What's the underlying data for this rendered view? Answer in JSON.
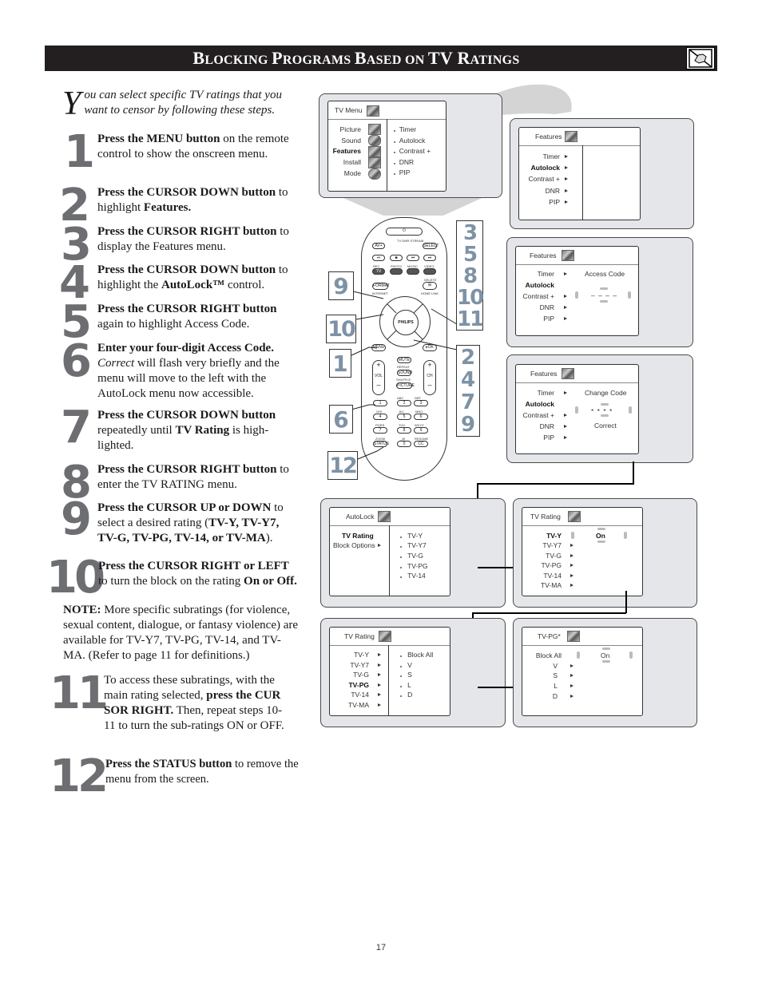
{
  "header": {
    "title_parts": [
      {
        "big": "B",
        "small": "LOCKING "
      },
      {
        "big": "P",
        "small": "ROGRAMS "
      },
      {
        "big": "B",
        "small": "ASED ON "
      },
      {
        "big": "TV R",
        "small": "ATINGS"
      }
    ],
    "icon": "hand-pointer-icon"
  },
  "intro": {
    "drop_cap": "Y",
    "text": "ou can select specific TV ratings that you want to censor by following these steps."
  },
  "steps": [
    {
      "num": "1",
      "bold": "Press the MENU button",
      "rest": " on the remote control to show the onscreen menu."
    },
    {
      "num": "2",
      "bold": "Press the CURSOR DOWN button",
      "rest": " to highlight ",
      "bold2": "Features."
    },
    {
      "num": "3",
      "bold": "Press the CURSOR RIGHT button",
      "rest": " to display the Features menu."
    },
    {
      "num": "4",
      "bold": "Press the CURSOR DOWN button",
      "rest": " to highlight the ",
      "bold2": "AutoLock™",
      "rest2": " control."
    },
    {
      "num": "5",
      "bold": "Press the CURSOR RIGHT button",
      "rest": " again to highlight Access Code."
    },
    {
      "num": "6",
      "bold": "Enter your four-digit Access Code.",
      "italic": "Correct",
      "rest": " will flash very briefly and the menu will move to the left with the AutoLock menu now accessible."
    },
    {
      "num": "7",
      "bold": "Press the CURSOR DOWN button",
      "rest": " repeatedly until ",
      "bold2": "TV Rating",
      "rest2": " is high-lighted."
    },
    {
      "num": "8",
      "bold": "Press the CURSOR RIGHT button",
      "rest": " to enter the TV RATING menu."
    },
    {
      "num": "9",
      "bold": "Press the CURSOR UP or DOWN",
      "rest": " to select a desired rating (",
      "bold2": "TV-Y, TV-Y7, TV-G, TV-PG, TV-14, or TV-MA",
      "rest2": ")."
    },
    {
      "num": "10",
      "bold": "Press the CURSOR RIGHT or LEFT",
      "rest": " to turn the block on the rating ",
      "bold2": "On or Off."
    },
    {
      "num": "11",
      "rest": "To access these subratings, with the main rating selected, ",
      "bold": "press the CUR SOR RIGHT.",
      "rest2": " Then, repeat steps 10-11 to turn the sub-ratings ON or OFF."
    },
    {
      "num": "12",
      "bold": "Press the STATUS button",
      "rest": " to remove the menu from the screen."
    }
  ],
  "note": {
    "label": "NOTE:",
    "text": " More specific subratings (for violence, sexual content, dialogue, or fantasy violence) are available for TV-Y7, TV-PG, TV-14, and TV-MA. (Refer to page 11 for definitions.)"
  },
  "screens": {
    "tv_menu": {
      "title": "TV Menu",
      "left": [
        "Picture",
        "Sound",
        "Features",
        "Install",
        "Mode"
      ],
      "highlight": "Features",
      "right": [
        "Timer",
        "Autolock",
        "Contrast +",
        "DNR",
        "PIP"
      ]
    },
    "features_1": {
      "title": "Features",
      "items": [
        "Timer",
        "Autolock",
        "Contrast +",
        "DNR",
        "PIP"
      ],
      "highlight": "Autolock"
    },
    "features_2": {
      "title": "Features",
      "items": [
        "Timer",
        "Autolock",
        "Contrast +",
        "DNR",
        "PIP"
      ],
      "highlight": "Autolock",
      "field_label": "Access Code",
      "field_value": "– – – –"
    },
    "features_3": {
      "title": "Features",
      "items": [
        "Timer",
        "Autolock",
        "Contrast +",
        "DNR",
        "PIP"
      ],
      "highlight": "Autolock",
      "field_label": "Change Code",
      "field_value": "* * * *",
      "status": "Correct"
    },
    "autolock": {
      "title": "AutoLock",
      "left": [
        "TV Rating",
        "Block Options"
      ],
      "highlight": "TV Rating",
      "right": [
        "TV-Y",
        "TV-Y7",
        "TV-G",
        "TV-PG",
        "TV-14"
      ]
    },
    "tv_rating_1": {
      "title": "TV Rating",
      "items": [
        "TV-Y",
        "TV-Y7",
        "TV-G",
        "TV-PG",
        "TV-14",
        "TV-MA"
      ],
      "highlight": "TV-Y",
      "value": "On"
    },
    "tv_rating_2": {
      "title": "TV Rating",
      "items": [
        "TV-Y",
        "TV-Y7",
        "TV-G",
        "TV-PG",
        "TV-14",
        "TV-MA"
      ],
      "highlight": "TV-PG",
      "right": [
        "Block All",
        "V",
        "S",
        "L",
        "D"
      ]
    },
    "tv_pg": {
      "title": "TV-PG*",
      "items": [
        "Block All",
        "V",
        "S",
        "L",
        "D"
      ],
      "highlight": "Block All",
      "value": "On"
    }
  },
  "remote": {
    "brand": "PHILIPS",
    "top_labels": [
      "TV",
      "DMR",
      "STREAM"
    ],
    "buttons": {
      "av": "AV+",
      "select": "SELECT",
      "tv": "TV",
      "format": "FORMAT",
      "internet": "INTERNET",
      "home_link": "HOME LINK",
      "delete": "DELETE",
      "menu": "MENU",
      "ok": "▸OK",
      "mute": "MUTE",
      "repeat": "REPEAT",
      "sound": "SOUND",
      "shuffle": "SHUFFLE",
      "picture": "PICTURE",
      "vol": "VOL",
      "ch": "CH",
      "zoom": "ZOOM",
      "status": "STATUS",
      "resume": "RESUME",
      "cc": "CC",
      "row_labels": [
        "REC",
        "PHOTO",
        "MUSIC",
        "VIDEO"
      ],
      "digits": [
        "1",
        "2",
        "3",
        "4",
        "5",
        "6",
        "7",
        "8",
        "9",
        "0"
      ],
      "digit_labels": [
        ".",
        "ABC",
        "DEF",
        "GHI",
        "JKL",
        "MNO",
        "PQRS",
        "TUV",
        "WXYZ",
        "_@"
      ]
    },
    "callouts": {
      "left_9": "9",
      "left_10": "10",
      "left_1": "1",
      "left_6": "6",
      "left_12": "12",
      "right_top": [
        "3",
        "5",
        "8",
        "10",
        "11"
      ],
      "right_bottom": [
        "2",
        "4",
        "7",
        "9"
      ]
    }
  },
  "page_number": "17"
}
